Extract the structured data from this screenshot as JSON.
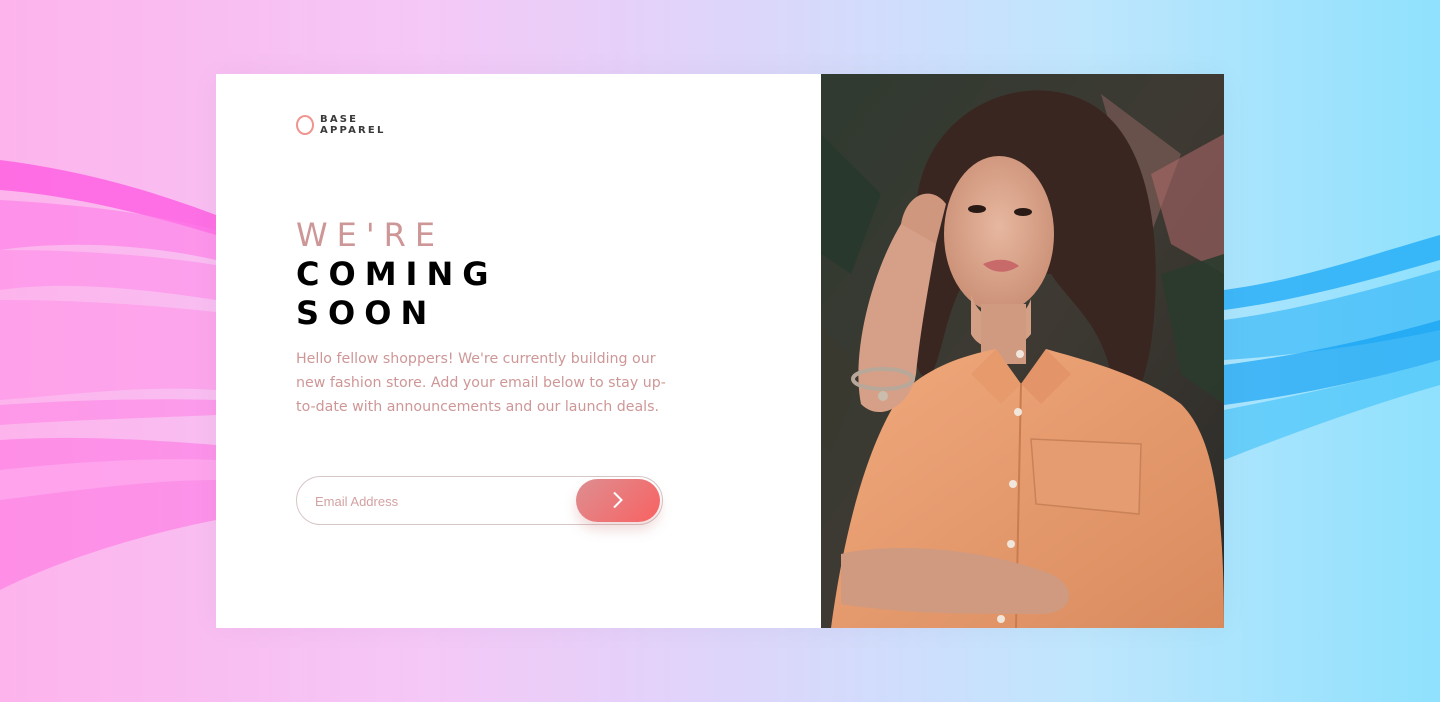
{
  "brand": {
    "line1": "BASE",
    "line2": "APPAREL"
  },
  "hero": {
    "line1": "WE'RE",
    "line2": "COMING",
    "line3": "SOON",
    "description": "Hello fellow shoppers! We're currently building our new fashion store. Add your email below to stay up-to-date with announcements and our launch deals."
  },
  "form": {
    "email_placeholder": "Email Address",
    "submit_icon": "chevron-right-icon"
  },
  "colors": {
    "accent": "#ce9797",
    "button_start": "#dd8e91",
    "button_end": "#f96262",
    "heading": "#000000",
    "shirt": "#e59a6c"
  }
}
